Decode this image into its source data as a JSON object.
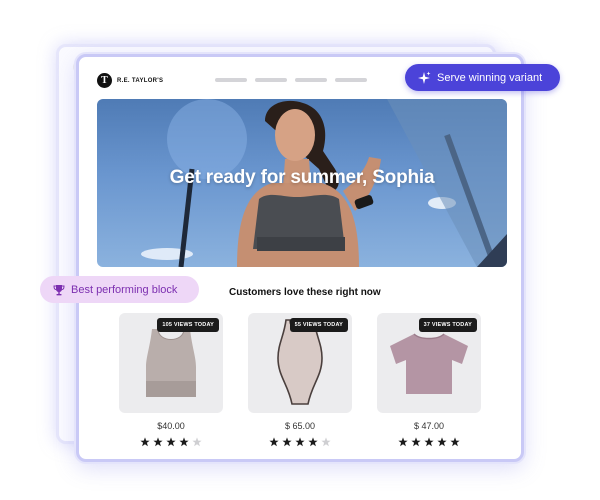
{
  "brand": {
    "logo_letter": "T",
    "name": "R.E. TAYLOR'S"
  },
  "hero": {
    "headline": "Get ready for summer, Sophia"
  },
  "section": {
    "title": "Customers love these right now"
  },
  "products": [
    {
      "views": "105 VIEWS TODAY",
      "price": "$40.00",
      "rating": 4,
      "max_rating": 5,
      "item": "sports-bra"
    },
    {
      "views": "55 VIEWS TODAY",
      "price": "$ 65.00",
      "rating": 4,
      "max_rating": 5,
      "item": "swimsuit"
    },
    {
      "views": "37 VIEWS TODAY",
      "price": "$ 47.00",
      "rating": 5,
      "max_rating": 5,
      "item": "t-shirt"
    }
  ],
  "badges": {
    "serve": {
      "label": "Serve winning variant",
      "icon": "sparkle-icon"
    },
    "best": {
      "label": "Best performing block",
      "icon": "trophy-icon"
    }
  },
  "colors": {
    "accent": "#4b43d9",
    "best_bg": "#eed7f7",
    "best_text": "#7c2fb0",
    "star_filled": "#1b1b1b",
    "star_empty": "#cfcfd2"
  }
}
